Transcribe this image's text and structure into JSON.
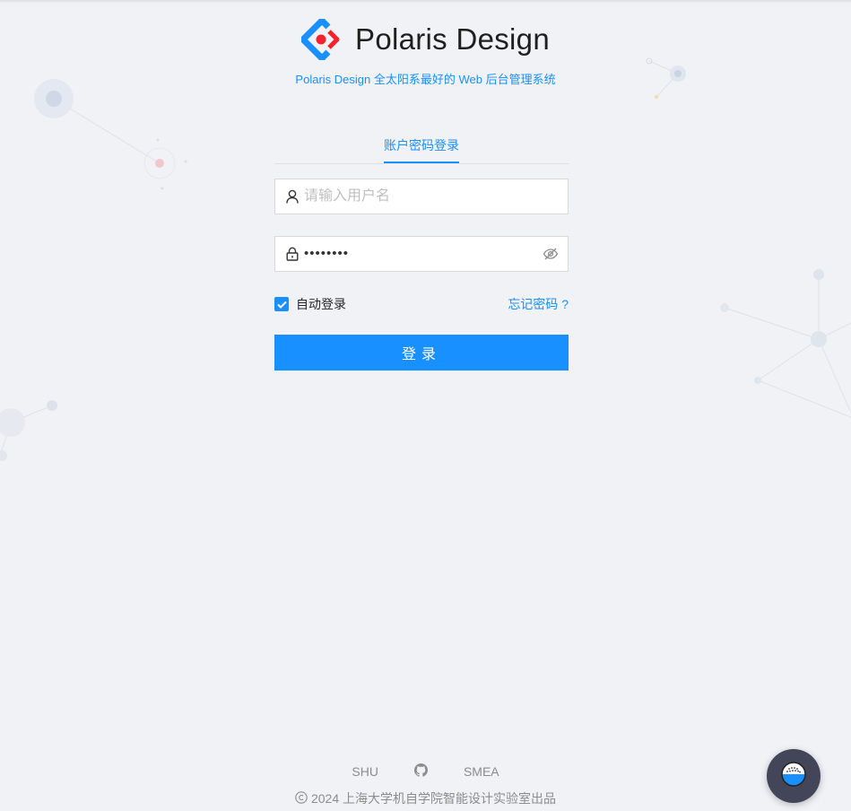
{
  "brand": {
    "title": "Polaris Design",
    "subtitle": "Polaris Design 全太阳系最好的 Web 后台管理系统"
  },
  "login": {
    "tab_label": "账户密码登录",
    "username_placeholder": "请输入用户名",
    "password_mask": "••••••••",
    "remember_label": "自动登录",
    "remember_checked": true,
    "forgot_label": "忘记密码 ?",
    "submit_label": "登录"
  },
  "footer": {
    "links": [
      "SHU",
      "SMEA"
    ],
    "copyright": "2024 上海大学机自学院智能设计实验室出品"
  },
  "colors": {
    "accent": "#1890ff",
    "background": "#f0f2f5",
    "fab": "#434659"
  },
  "icons": [
    "logo-icon",
    "user-icon",
    "lock-icon",
    "eye-off-icon",
    "github-icon",
    "copyright-icon",
    "chat-bot-icon"
  ]
}
